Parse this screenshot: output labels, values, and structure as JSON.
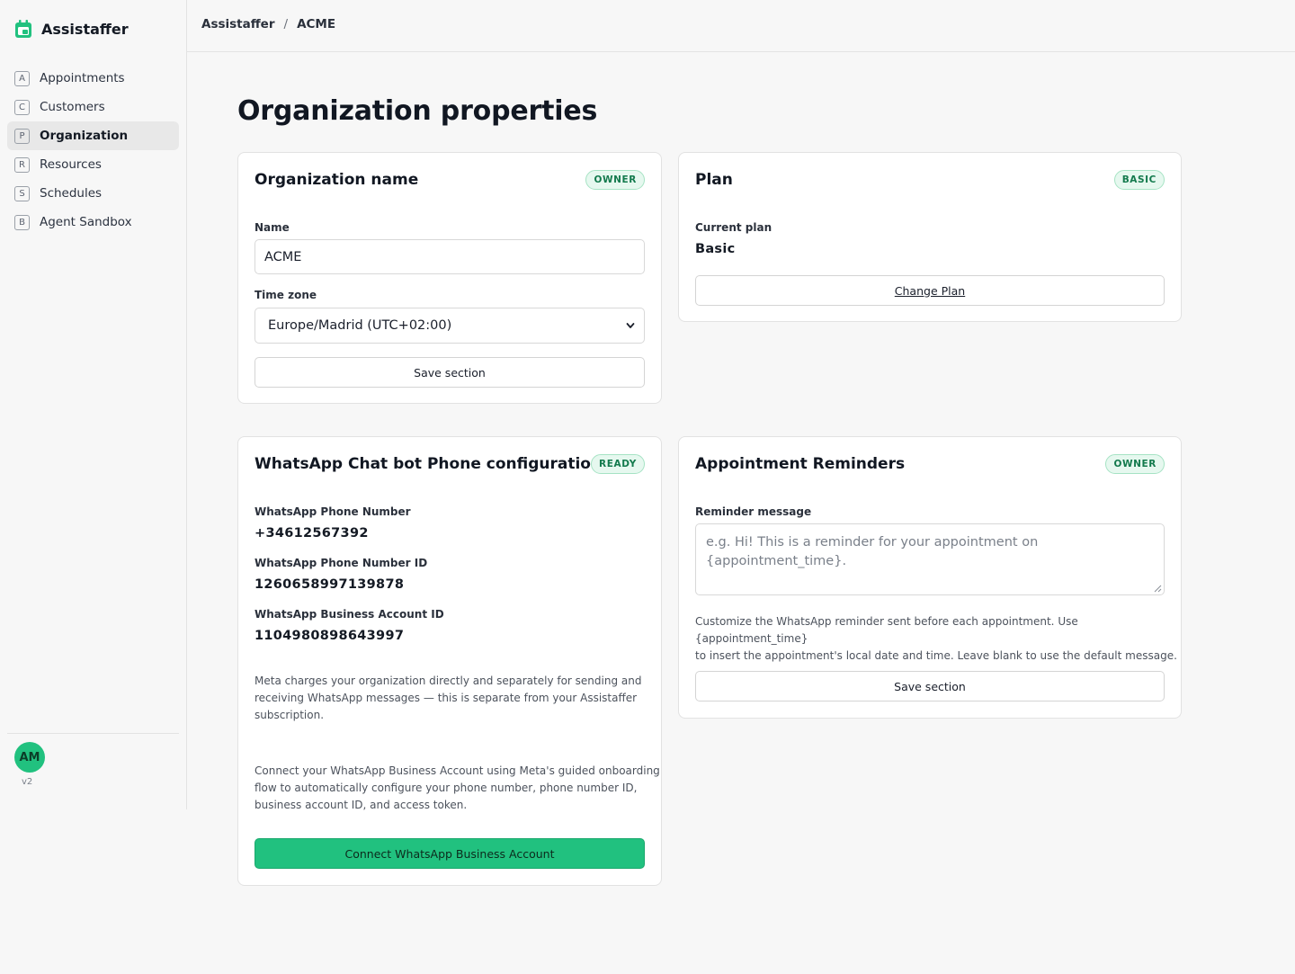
{
  "brand": {
    "name": "Assistaffer",
    "accent": "#21c17f"
  },
  "sidebar": {
    "items": [
      {
        "key": "A",
        "label": "Appointments",
        "active": false
      },
      {
        "key": "C",
        "label": "Customers",
        "active": false
      },
      {
        "key": "P",
        "label": "Organization",
        "active": true
      },
      {
        "key": "R",
        "label": "Resources",
        "active": false
      },
      {
        "key": "S",
        "label": "Schedules",
        "active": false
      },
      {
        "key": "B",
        "label": "Agent Sandbox",
        "active": false
      }
    ],
    "avatar_initials": "AM",
    "version": "v2"
  },
  "breadcrumb": {
    "root": "Assistaffer",
    "separator": "/",
    "current": "ACME"
  },
  "page": {
    "title": "Organization properties"
  },
  "org_card": {
    "title": "Organization name",
    "badge": "OWNER",
    "name_label": "Name",
    "name_value": "ACME",
    "timezone_label": "Time zone",
    "timezone_value": "Europe/Madrid (UTC+02:00)",
    "save_label": "Save section"
  },
  "plan_card": {
    "title": "Plan",
    "badge": "BASIC",
    "current_label": "Current plan",
    "current_value": "Basic",
    "change_label": "Change Plan"
  },
  "whatsapp_card": {
    "title": "WhatsApp Chat bot Phone configuration",
    "badge": "READY",
    "phone_label": "WhatsApp Phone Number",
    "phone_value": "+34612567392",
    "phone_id_label": "WhatsApp Phone Number ID",
    "phone_id_value": "1260658997139878",
    "business_id_label": "WhatsApp Business Account ID",
    "business_id_value": "1104980898643997",
    "meta_note_1": "Meta charges your organization directly and separately for sending and",
    "meta_note_2": "receiving WhatsApp messages — this is separate from your Assistaffer",
    "meta_note_3": "subscription.",
    "connect_note_1": "Connect your WhatsApp Business Account using Meta's guided onboarding",
    "connect_note_2": "flow to automatically configure your phone number, phone number ID,",
    "connect_note_3": "business account ID, and access token.",
    "connect_label": "Connect WhatsApp Business Account"
  },
  "reminders_card": {
    "title": "Appointment Reminders",
    "badge": "OWNER",
    "message_label": "Reminder message",
    "message_placeholder_1": "e.g. Hi! This is a reminder for your appointment on",
    "message_placeholder_2": "{appointment_time}.",
    "help_1": "Customize the WhatsApp reminder sent before each appointment. Use {appointment_time}",
    "help_2": "to insert the appointment's local date and time. Leave blank to use the default message.",
    "save_label": "Save section"
  }
}
